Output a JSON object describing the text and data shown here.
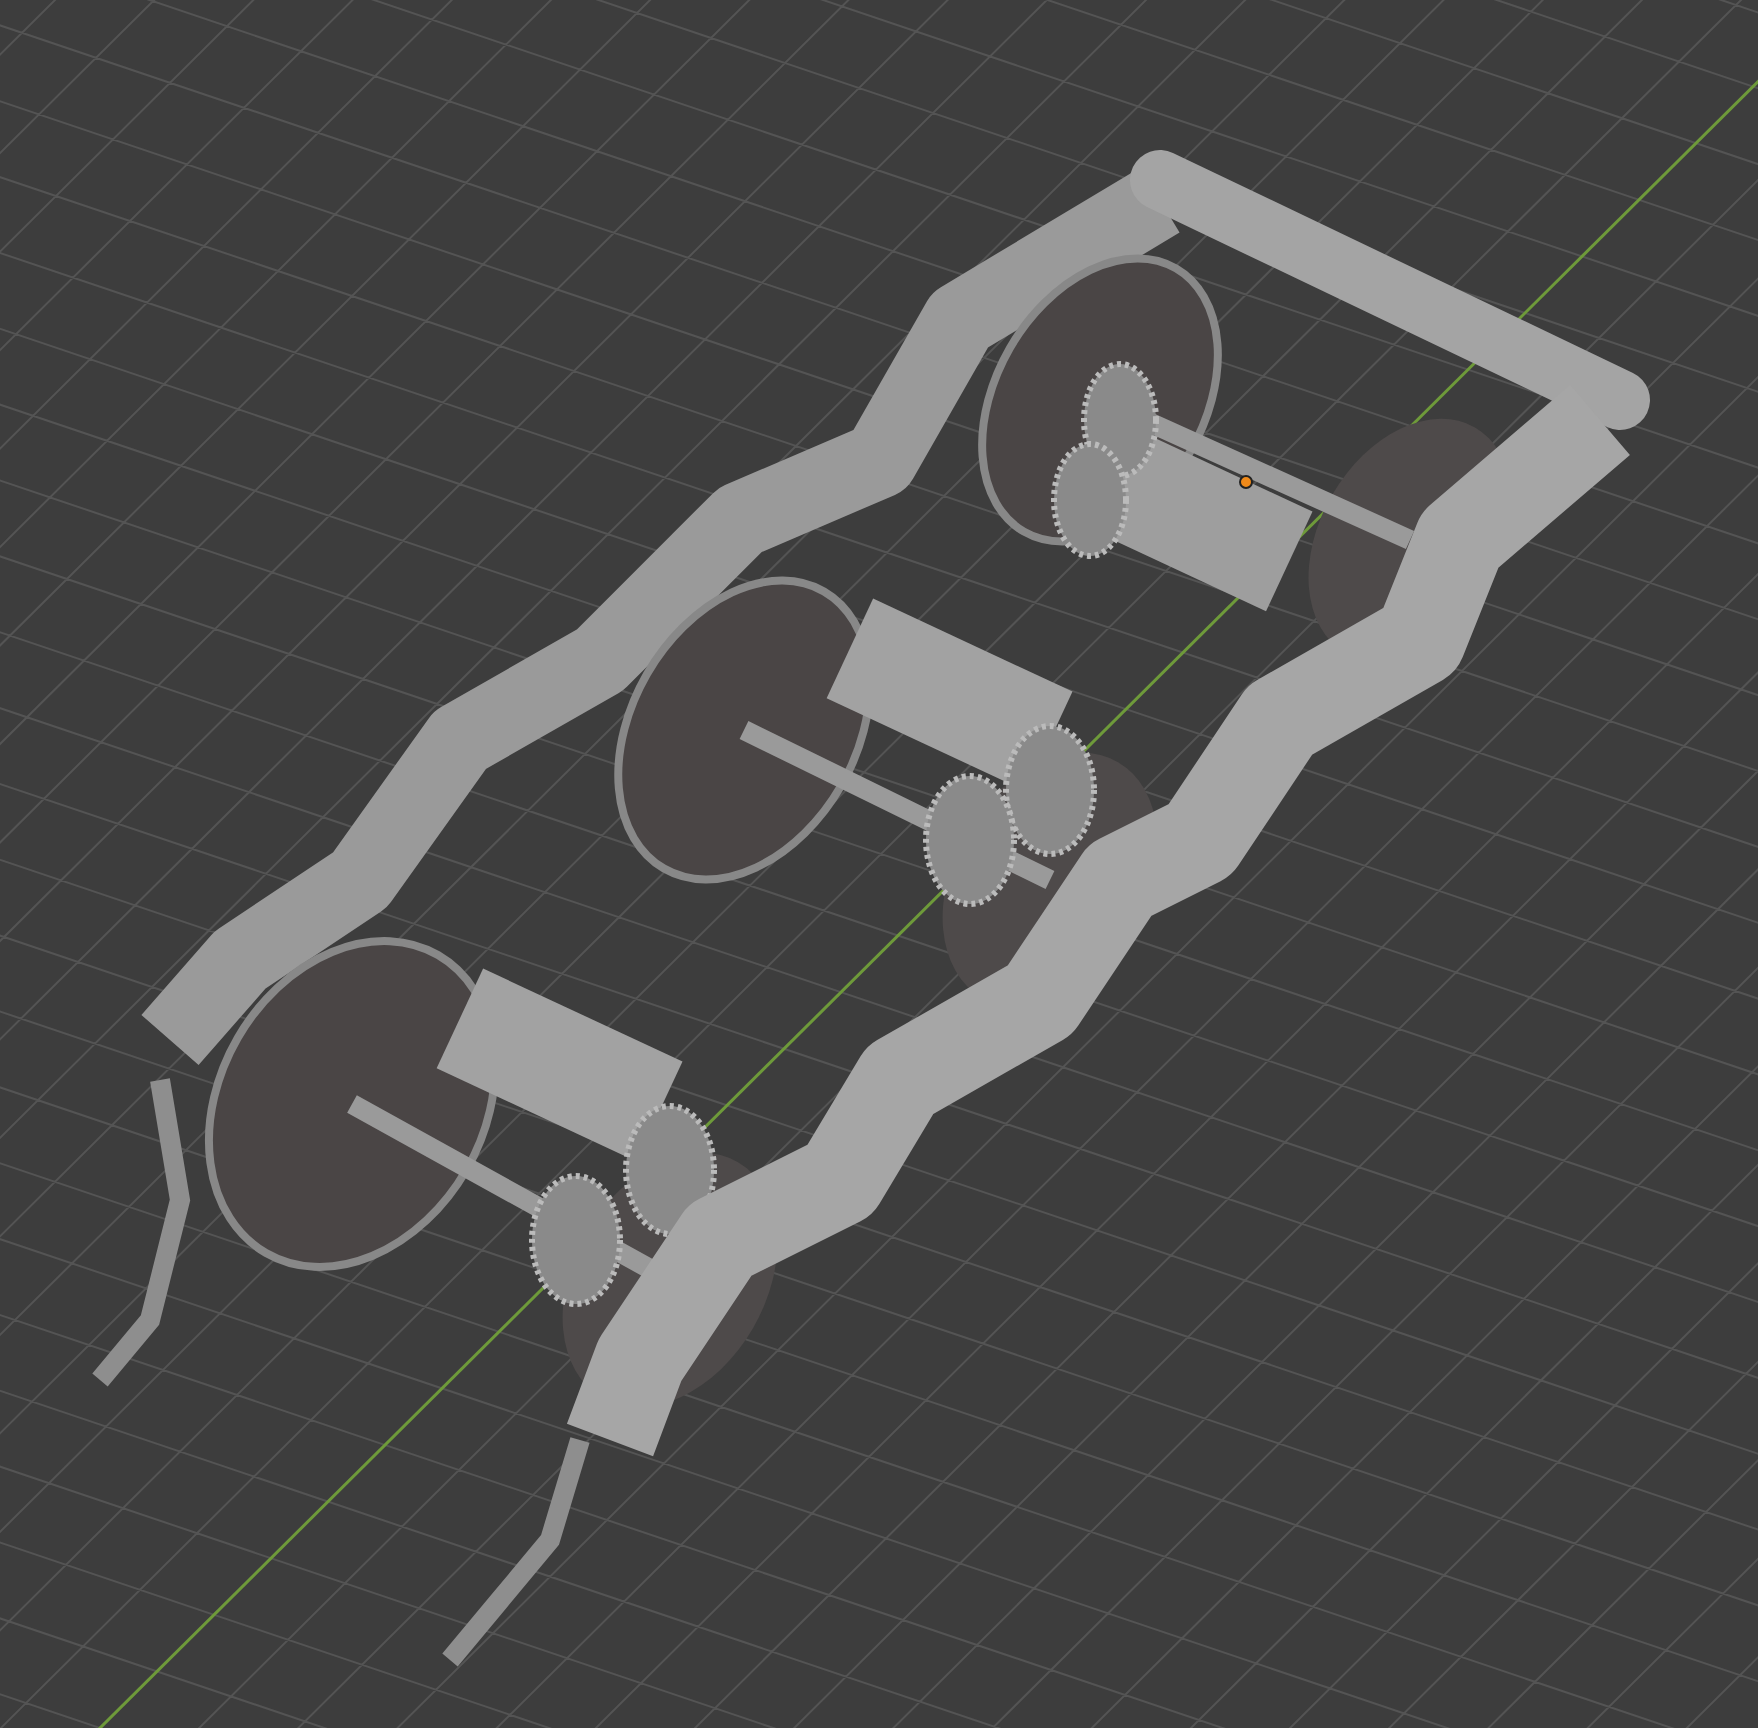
{
  "viewport": {
    "show_grid": true,
    "show_axis_line": true,
    "show_origin": true
  }
}
